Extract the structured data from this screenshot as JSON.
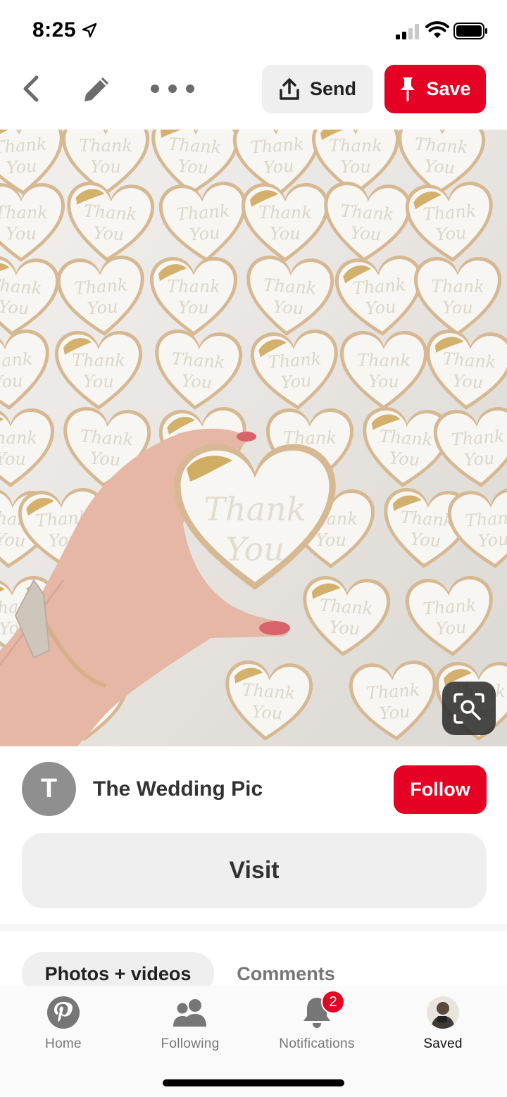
{
  "status_bar": {
    "time": "8:25",
    "icons": [
      "location-arrow-icon",
      "signal-icon",
      "wifi-icon",
      "battery-icon"
    ]
  },
  "toolbar": {
    "back_icon": "chevron-left-icon",
    "edit_icon": "pencil-icon",
    "more_icon": "ellipsis-icon",
    "send_label": "Send",
    "save_label": "Save"
  },
  "pin": {
    "cookie_text_line1": "Thank",
    "cookie_text_line2": "You",
    "lens_icon": "visual-search-icon"
  },
  "creator": {
    "avatar_letter": "T",
    "name": "The Wedding Pic",
    "follow_label": "Follow"
  },
  "visit": {
    "label": "Visit"
  },
  "tabs": [
    {
      "label": "Photos + videos",
      "active": true
    },
    {
      "label": "Comments",
      "active": false
    }
  ],
  "bottom_nav": {
    "items": [
      {
        "label": "Home",
        "icon": "pinterest-logo-icon"
      },
      {
        "label": "Following",
        "icon": "people-icon"
      },
      {
        "label": "Notifications",
        "icon": "bell-icon",
        "badge": "2"
      },
      {
        "label": "Saved",
        "icon": "profile-avatar"
      }
    ]
  },
  "colors": {
    "brand_red": "#e60023",
    "button_gray": "#efefef"
  }
}
